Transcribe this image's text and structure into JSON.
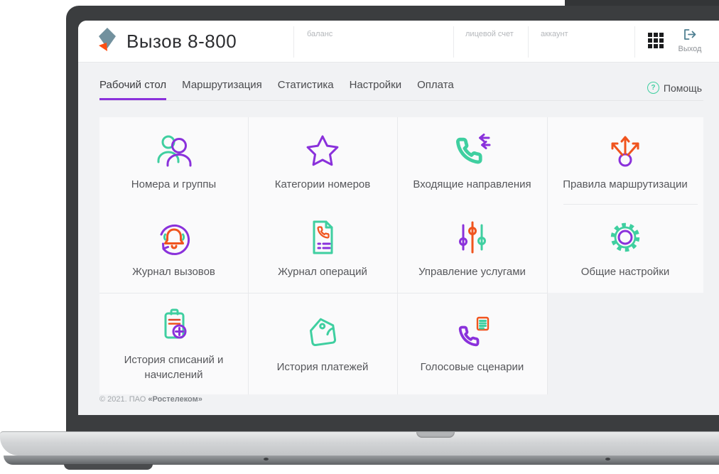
{
  "brand": {
    "title": "Вызов 8-800",
    "logo_icon": "rostelecom-logo-icon"
  },
  "header": {
    "fields": [
      {
        "label": "баланс"
      },
      {
        "label": "лицевой счет"
      },
      {
        "label": "аккаунт"
      }
    ],
    "apps_icon": "grid-apps-icon",
    "logout": {
      "label": "Выход",
      "icon": "exit-icon"
    }
  },
  "nav": {
    "tabs": [
      {
        "label": "Рабочий стол",
        "active": true
      },
      {
        "label": "Маршрутизация",
        "active": false
      },
      {
        "label": "Статистика",
        "active": false
      },
      {
        "label": "Настройки",
        "active": false
      },
      {
        "label": "Оплата",
        "active": false
      }
    ],
    "help": {
      "label": "Помощь",
      "icon": "help-question-icon"
    }
  },
  "tiles": [
    {
      "label": "Номера и группы",
      "icon": "users-icon"
    },
    {
      "label": "Категории номеров",
      "icon": "star-icon"
    },
    {
      "label": "Входящие направления",
      "icon": "incoming-call-icon"
    },
    {
      "label": "Правила маршрутизации",
      "icon": "routing-arrows-icon"
    },
    {
      "label": "Журнал вызовов",
      "icon": "call-log-bell-icon"
    },
    {
      "label": "Журнал операций",
      "icon": "operations-doc-icon"
    },
    {
      "label": "Управление услугами",
      "icon": "sliders-icon"
    },
    {
      "label": "Общие настройки",
      "icon": "gear-icon"
    },
    {
      "label": "История списаний и начислений",
      "icon": "clipboard-plus-icon"
    },
    {
      "label": "История платежей",
      "icon": "wallet-icon"
    },
    {
      "label": "Голосовые сценарии",
      "icon": "voice-script-icon"
    }
  ],
  "footer": {
    "copyright": "© 2021. ПАО ",
    "company": "«Ростелеком»"
  },
  "colors": {
    "purple": "#8A31DB",
    "teal": "#3FCFA0",
    "orange": "#F0541E",
    "red": "#D9442B",
    "slate": "#72919E",
    "logo_orange": "#FF4F12",
    "exit": "#4E7F91",
    "dark": "#1B1C1E",
    "tilebg": "#FAFAFB"
  }
}
